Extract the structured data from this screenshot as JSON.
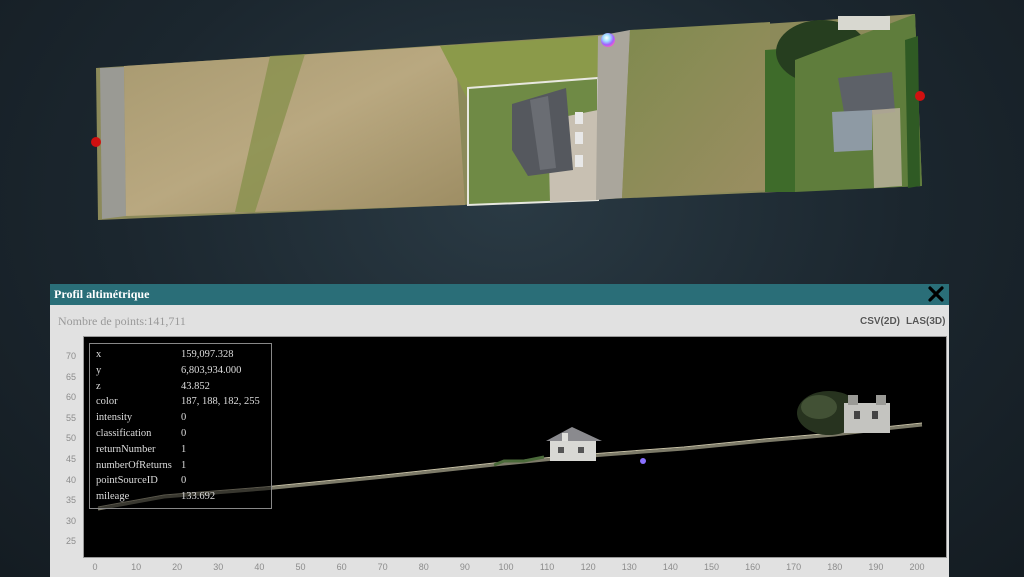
{
  "profile": {
    "title": "Profil altimétrique",
    "point_count": "Nombre de points:141,711",
    "export_csv": "CSV(2D)",
    "export_las": "LAS(3D)",
    "y_ticks": [
      "70",
      "65",
      "60",
      "55",
      "50",
      "45",
      "40",
      "35",
      "30",
      "25"
    ],
    "x_ticks": [
      "0",
      "10",
      "20",
      "30",
      "40",
      "50",
      "60",
      "70",
      "80",
      "90",
      "100",
      "110",
      "120",
      "130",
      "140",
      "150",
      "160",
      "170",
      "180",
      "190",
      "200"
    ],
    "info": [
      {
        "key": "x",
        "value": "159,097.328"
      },
      {
        "key": "y",
        "value": "6,803,934.000"
      },
      {
        "key": "z",
        "value": "43.852"
      },
      {
        "key": "color",
        "value": "187, 188, 182, 255"
      },
      {
        "key": "intensity",
        "value": "0"
      },
      {
        "key": "classification",
        "value": "0"
      },
      {
        "key": "returnNumber",
        "value": "1"
      },
      {
        "key": "numberOfReturns",
        "value": "1"
      },
      {
        "key": "pointSourceID",
        "value": "0"
      },
      {
        "key": "mileage",
        "value": "133.692"
      }
    ]
  },
  "colors": {
    "panel_header": "#2a6e78",
    "background": "#1b262e",
    "marker_red": "#d01010"
  },
  "icons": {
    "close": "close-icon"
  }
}
